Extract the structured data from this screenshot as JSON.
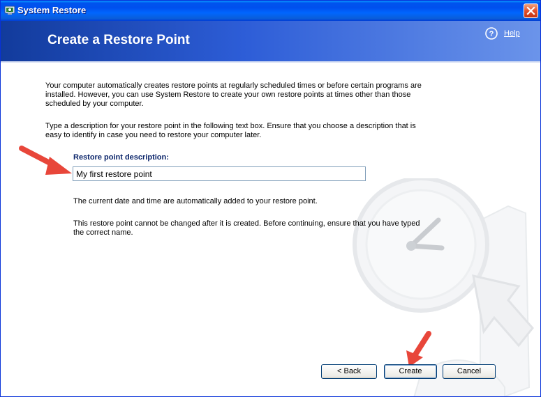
{
  "window": {
    "title": "System Restore"
  },
  "banner": {
    "heading": "Create a Restore Point",
    "help_link": "Help"
  },
  "content": {
    "intro": "Your computer automatically creates restore points at regularly scheduled times or before certain programs are installed. However, you can use System Restore to create your own restore points at times other than those scheduled by your computer.",
    "instructions": "Type a description for your restore point in the following text box. Ensure that you choose a description that is easy to identify in case you need to restore your computer later.",
    "field_label": "Restore point description:",
    "field_value": "My first restore point",
    "note_datetime": "The current date and time are automatically added to your restore point.",
    "note_warning": "This restore point cannot be changed after it is created. Before continuing, ensure that you have typed the correct name."
  },
  "buttons": {
    "back": "< Back",
    "create": "Create",
    "cancel": "Cancel"
  },
  "icons": [
    "system-restore-icon",
    "close-icon",
    "help-icon",
    "red-arrow-annotation",
    "clock-watermark"
  ],
  "colors": {
    "titlebar": "#0055ea",
    "banner": "#2d5dd7",
    "label": "#0a246a",
    "annotation_arrow": "#e8463a"
  }
}
